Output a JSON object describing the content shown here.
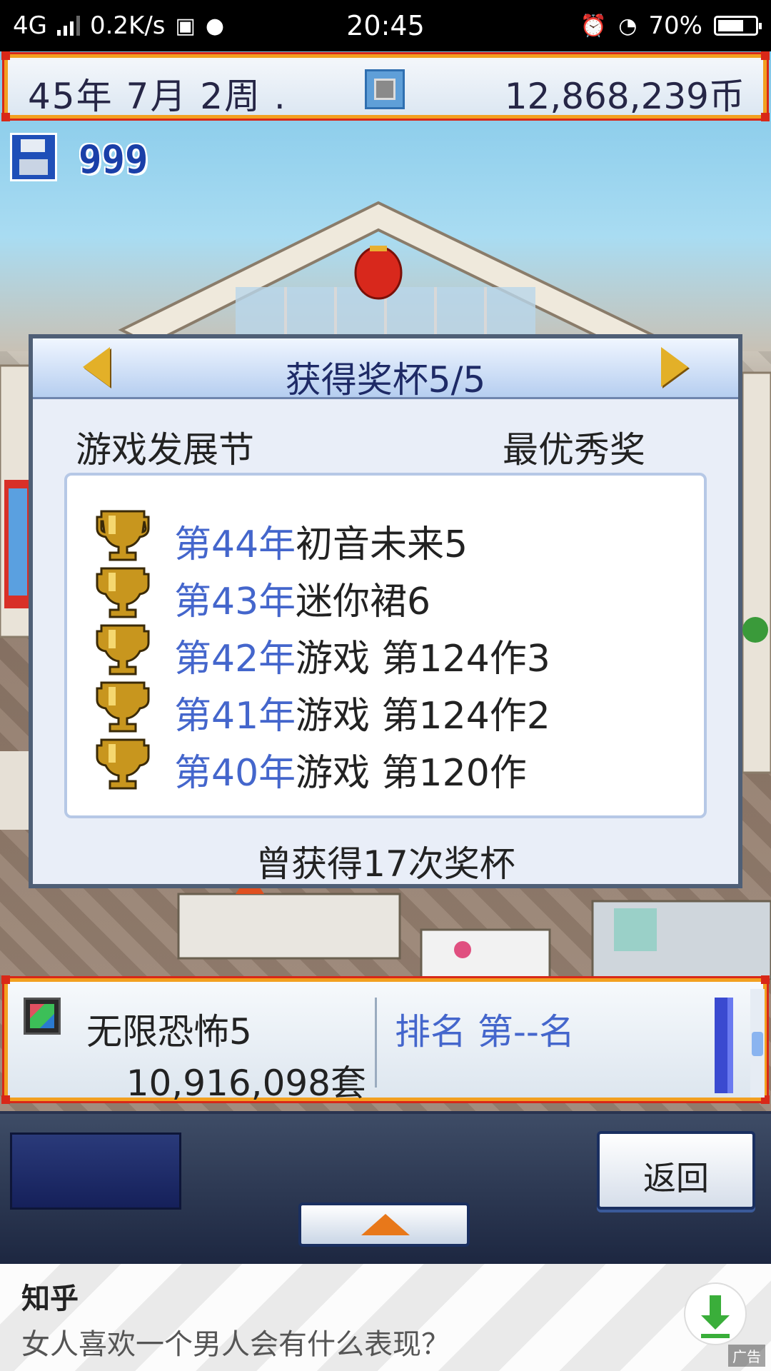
{
  "status_bar": {
    "network": "4G",
    "speed": "0.2K/s",
    "time": "20:45",
    "battery": "70%",
    "battery_level": 0.7
  },
  "top_bar": {
    "date": "45年 7月 2周 .",
    "money": "12,868,239币"
  },
  "disk": {
    "count": "999",
    "icon": "floppy-disk-icon"
  },
  "award_dialog": {
    "title": "获得奖杯5/5",
    "festival": "游戏发展节",
    "award": "最优秀奖",
    "entries": [
      {
        "year": "第44年",
        "game": "初音未来5"
      },
      {
        "year": "第43年",
        "game": "迷你裙6"
      },
      {
        "year": "第42年",
        "game": "游戏 第124作3"
      },
      {
        "year": "第41年",
        "game": "游戏 第124作2"
      },
      {
        "year": "第40年",
        "game": "游戏 第120作"
      }
    ],
    "total": "曾获得17次奖杯"
  },
  "info_bar": {
    "game_name": "无限恐怖5",
    "sales": "10,916,098套",
    "rank": "排名 第--名"
  },
  "controls": {
    "back_label": "返回"
  },
  "ad": {
    "brand": "知乎",
    "question": "女人喜欢一个男人会有什么表现？",
    "tag": "广告"
  },
  "colors": {
    "frame_orange": "#f2a020",
    "frame_red": "#d82818",
    "year_blue": "#4466cc",
    "title_navy": "#1e2a66"
  }
}
